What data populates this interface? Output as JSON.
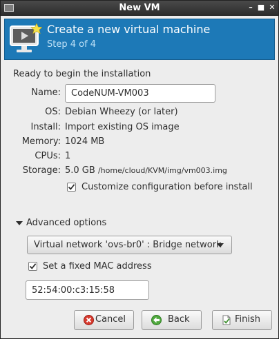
{
  "window": {
    "title": "New VM"
  },
  "banner": {
    "heading": "Create a new virtual machine",
    "step": "Step 4 of 4"
  },
  "summary": {
    "ready_text": "Ready to begin the installation",
    "name_label": "Name:",
    "name_value": "CodeNUM-VM003",
    "os_label": "OS:",
    "os_value": "Debian Wheezy (or later)",
    "install_label": "Install:",
    "install_value": "Import existing OS image",
    "memory_label": "Memory:",
    "memory_value": "1024 MB",
    "cpus_label": "CPUs:",
    "cpus_value": "1",
    "storage_label": "Storage:",
    "storage_size": "5.0 GB",
    "storage_path": "/home/cloud/KVM/img/vm003.img",
    "customize_label": "Customize configuration before install",
    "customize_checked": true
  },
  "advanced": {
    "expander_label": "Advanced options",
    "expanded": true,
    "network_selected": "Virtual network 'ovs-br0' : Bridge network",
    "fixed_mac_label": "Set a fixed MAC address",
    "fixed_mac_checked": true,
    "mac_value": "52:54:00:c3:15:58"
  },
  "buttons": {
    "cancel_label": "Cancel",
    "back_label": "Back",
    "finish_label": "Finish"
  },
  "icons": {
    "app": "app-window-icon",
    "minimize": "minimize-icon",
    "maximize": "maximize-icon",
    "close": "close-icon",
    "banner": "new-vm-monitor-icon",
    "cancel": "cancel-icon",
    "back": "back-arrow-icon",
    "finish": "finish-icon"
  },
  "colors": {
    "banner_bg": "#1d79b7",
    "step_text": "#bde0f6",
    "titlebar": "#2b2b2b",
    "window_bg": "#ededed"
  }
}
